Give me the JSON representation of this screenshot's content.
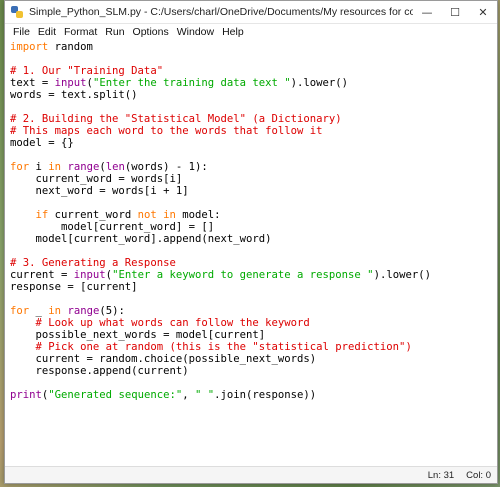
{
  "window": {
    "title": "Simple_Python_SLM.py - C:/Users/charl/OneDrive/Documents/My resources for commercial use/Simple_Python_SL...",
    "minimize_glyph": "—",
    "maximize_glyph": "☐",
    "close_glyph": "✕"
  },
  "menu": [
    "File",
    "Edit",
    "Format",
    "Run",
    "Options",
    "Window",
    "Help"
  ],
  "code_lines": [
    [
      [
        "kw",
        "import"
      ],
      [
        "",
        ""
      ],
      [
        "n",
        " random"
      ]
    ],
    [],
    [
      [
        "cm",
        "# 1. Our \"Training Data\""
      ]
    ],
    [
      [
        "n",
        "text = "
      ],
      [
        "bi",
        "input"
      ],
      [
        "n",
        "("
      ],
      [
        "st",
        "\"Enter the training data text \""
      ],
      [
        "n",
        ").lower()"
      ]
    ],
    [
      [
        "n",
        "words = text.split()"
      ]
    ],
    [],
    [
      [
        "cm",
        "# 2. Building the \"Statistical Model\" (a Dictionary)"
      ]
    ],
    [
      [
        "cm",
        "# This maps each word to the words that follow it"
      ]
    ],
    [
      [
        "n",
        "model = {}"
      ]
    ],
    [],
    [
      [
        "kw",
        "for"
      ],
      [
        "n",
        " i "
      ],
      [
        "kw",
        "in"
      ],
      [
        "n",
        " "
      ],
      [
        "bi",
        "range"
      ],
      [
        "n",
        "("
      ],
      [
        "bi",
        "len"
      ],
      [
        "n",
        "(words) - 1):"
      ]
    ],
    [
      [
        "n",
        "    current_word = words[i]"
      ]
    ],
    [
      [
        "n",
        "    next_word = words[i + 1]"
      ]
    ],
    [],
    [
      [
        "n",
        "    "
      ],
      [
        "kw",
        "if"
      ],
      [
        "n",
        " current_word "
      ],
      [
        "kw",
        "not in"
      ],
      [
        "n",
        " model:"
      ]
    ],
    [
      [
        "n",
        "        model[current_word] = []"
      ]
    ],
    [
      [
        "n",
        "    model[current_word].append(next_word)"
      ]
    ],
    [],
    [
      [
        "cm",
        "# 3. Generating a Response"
      ]
    ],
    [
      [
        "n",
        "current = "
      ],
      [
        "bi",
        "input"
      ],
      [
        "n",
        "("
      ],
      [
        "st",
        "\"Enter a keyword to generate a response \""
      ],
      [
        "n",
        ").lower()"
      ]
    ],
    [
      [
        "n",
        "response = [current]"
      ]
    ],
    [],
    [
      [
        "kw",
        "for"
      ],
      [
        "n",
        " _ "
      ],
      [
        "kw",
        "in"
      ],
      [
        "n",
        " "
      ],
      [
        "bi",
        "range"
      ],
      [
        "n",
        "(5):"
      ]
    ],
    [
      [
        "n",
        "    "
      ],
      [
        "cm",
        "# Look up what words can follow the keyword"
      ]
    ],
    [
      [
        "n",
        "    possible_next_words = model[current]"
      ]
    ],
    [
      [
        "n",
        "    "
      ],
      [
        "cm",
        "# Pick one at random (this is the \"statistical prediction\")"
      ]
    ],
    [
      [
        "n",
        "    current = random.choice(possible_next_words)"
      ]
    ],
    [
      [
        "n",
        "    response.append(current)"
      ]
    ],
    [],
    [
      [
        "bi",
        "print"
      ],
      [
        "n",
        "("
      ],
      [
        "st",
        "\"Generated sequence:\""
      ],
      [
        "n",
        ", "
      ],
      [
        "st",
        "\" \""
      ],
      [
        "n",
        ".join(response))"
      ]
    ]
  ],
  "status": {
    "line": "Ln: 31",
    "col": "Col: 0"
  },
  "colors": {
    "keyword": "#ff7700",
    "builtin": "#900090",
    "string": "#00aa00",
    "comment": "#dd0000"
  }
}
